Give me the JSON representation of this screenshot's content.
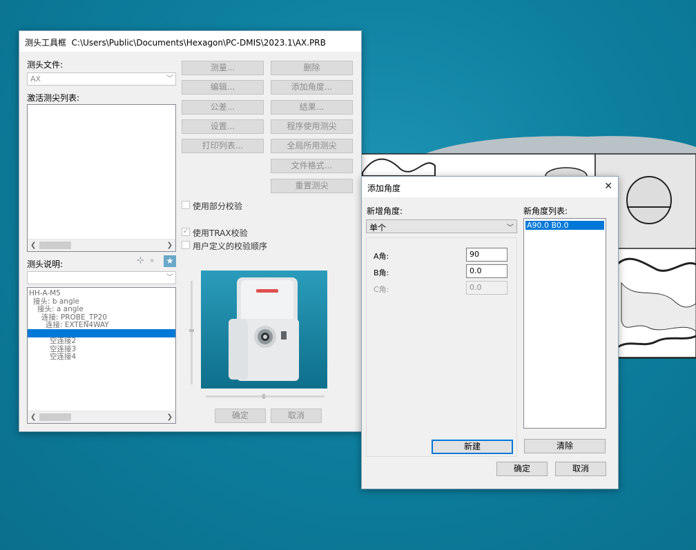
{
  "probe_window": {
    "title": "测头工具框",
    "path": "C:\\Users\\Public\\Documents\\Hexagon\\PC-DMIS\\2023.1\\AX.PRB",
    "probe_file_label": "测头文件:",
    "probe_file_value": "AX",
    "active_tips_label": "激活测尖列表:",
    "probe_desc_label": "测头说明:",
    "buttons_left": [
      "测量...",
      "编辑...",
      "公差...",
      "设置...",
      "打印列表..."
    ],
    "buttons_right": [
      "删除",
      "添加角度...",
      "结果...",
      "程序使用测尖",
      "全局所用测尖",
      "文件格式...",
      "重置测尖"
    ],
    "chk_partial": "使用部分校验",
    "chk_trax": "使用TRAX校验",
    "chk_user_order": "用户定义的校验顺序",
    "tree": [
      {
        "text": "HH-A-M5",
        "indent": 0
      },
      {
        "text": "接头: b angle",
        "indent": 1
      },
      {
        "text": "接头: a angle",
        "indent": 2
      },
      {
        "text": "连接: PROBE_TP20",
        "indent": 3
      },
      {
        "text": "连接: EXTEN4WAY",
        "indent": 4
      },
      {
        "text": "",
        "indent": 5,
        "selected": true
      },
      {
        "text": "空连接2",
        "indent": 5
      },
      {
        "text": "空连接3",
        "indent": 5
      },
      {
        "text": "空连接4",
        "indent": 5
      }
    ],
    "ok": "确定",
    "cancel": "取消"
  },
  "angle_dialog": {
    "title": "添加角度",
    "new_angle_label": "新增角度:",
    "mode_value": "单个",
    "a_label": "A角:",
    "a_value": "90",
    "b_label": "B角:",
    "b_value": "0.0",
    "c_label": "C角:",
    "c_value": "0.0",
    "new_button": "新建",
    "list_label": "新角度列表:",
    "list_items": [
      "A90.0 B0.0"
    ],
    "clear_button": "清除",
    "ok": "确定",
    "cancel": "取消",
    "close_glyph": "✕"
  },
  "colors": {
    "accent": "#0078d7",
    "desktop": "#0d7f9f",
    "probe_viewport": "#1585a4"
  }
}
